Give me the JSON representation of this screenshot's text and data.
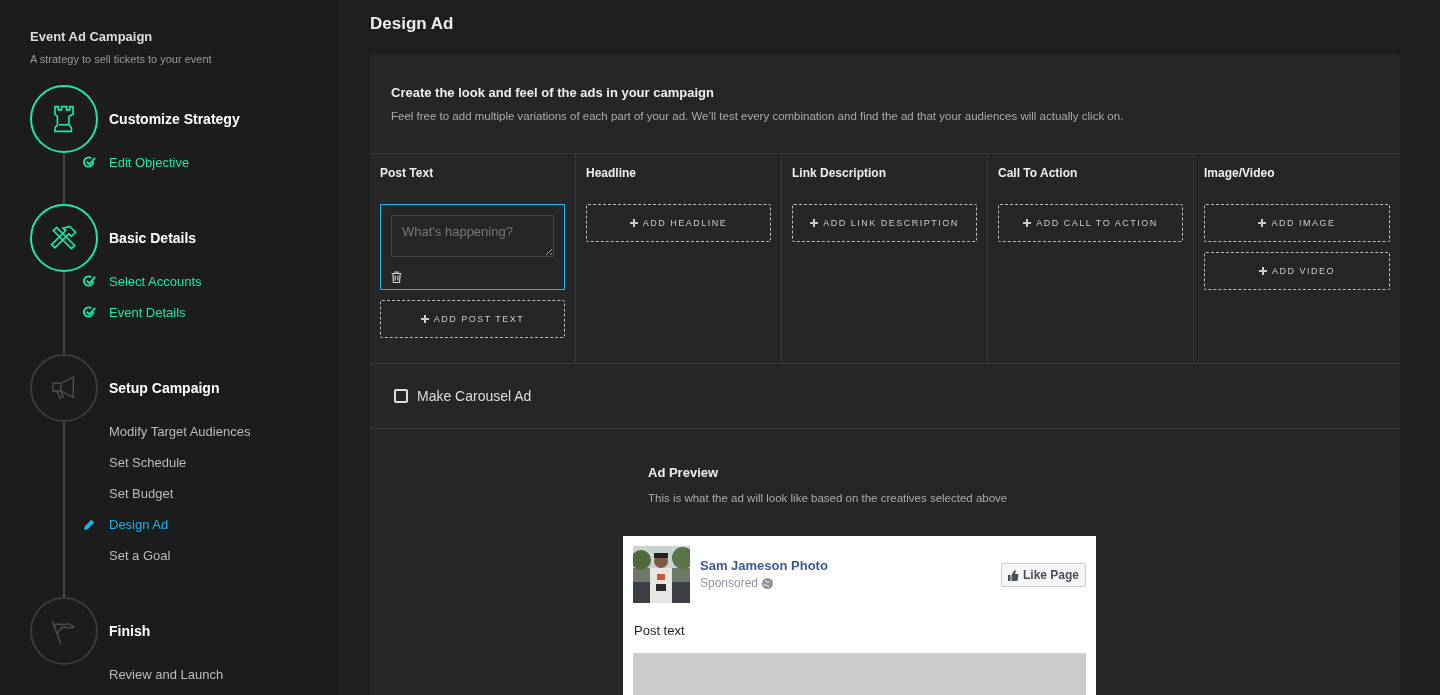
{
  "sidebar": {
    "title": "Event Ad Campaign",
    "subtitle": "A strategy to sell tickets to your event",
    "steps": [
      {
        "kind": "tower",
        "title": "Customize Strategy",
        "completed": true,
        "items": [
          {
            "label": "Edit Objective",
            "done": true,
            "selected": false
          }
        ]
      },
      {
        "kind": "tools",
        "title": "Basic Details",
        "completed": true,
        "items": [
          {
            "label": "Select Accounts",
            "done": true,
            "selected": false
          },
          {
            "label": "Event Details",
            "done": true,
            "selected": false
          }
        ]
      },
      {
        "kind": "megaphone",
        "title": "Setup Campaign",
        "completed": false,
        "items": [
          {
            "label": "Modify Target Audiences",
            "done": false,
            "selected": false
          },
          {
            "label": "Set Schedule",
            "done": false,
            "selected": false
          },
          {
            "label": "Set Budget",
            "done": false,
            "selected": false
          },
          {
            "label": "Design Ad",
            "done": false,
            "selected": true
          },
          {
            "label": "Set a Goal",
            "done": false,
            "selected": false
          }
        ]
      },
      {
        "kind": "flag",
        "title": "Finish",
        "completed": false,
        "items": [
          {
            "label": "Review and Launch",
            "done": false,
            "selected": false
          }
        ]
      }
    ]
  },
  "page_title": "Design Ad",
  "intro": {
    "heading": "Create the look and feel of the ads in your campaign",
    "text": "Feel free to add multiple variations of each part of your ad. We’ll test every combination and find the ad that your audiences will actually click on."
  },
  "columns": [
    {
      "heading": "Post Text",
      "entries": [
        {
          "placeholder": "What's happening?"
        }
      ],
      "buttons": [
        "ADD POST TEXT"
      ]
    },
    {
      "heading": "Headline",
      "buttons": [
        "ADD HEADLINE"
      ]
    },
    {
      "heading": "Link Description",
      "buttons": [
        "ADD LINK DESCRIPTION"
      ]
    },
    {
      "heading": "Call To Action",
      "buttons": [
        "ADD CALL TO ACTION"
      ]
    },
    {
      "heading": "Image/Video",
      "buttons": [
        "ADD IMAGE",
        "ADD VIDEO"
      ]
    }
  ],
  "carousel": {
    "label": "Make Carousel Ad",
    "checked": false
  },
  "preview": {
    "title": "Ad Preview",
    "subtitle": "This is what the ad will look like based on the creatives selected above",
    "card": {
      "page_name": "Sam Jameson Photo",
      "sponsored": "Sponsored",
      "like_button": "Like Page",
      "post_text": "Post text"
    }
  }
}
